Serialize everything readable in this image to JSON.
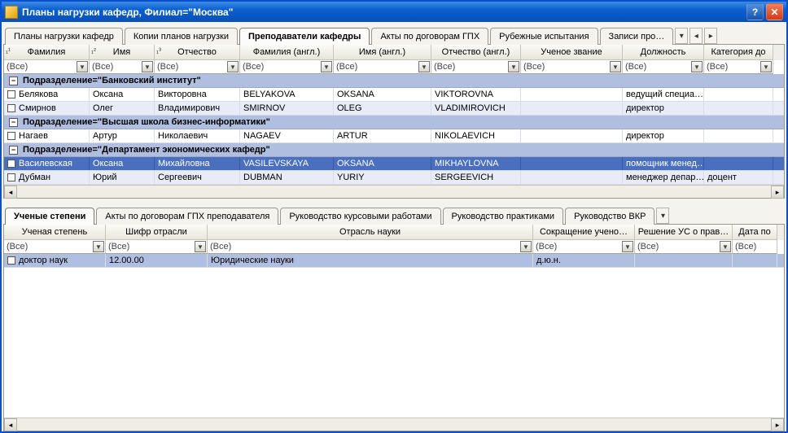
{
  "window": {
    "title": "Планы нагрузки кафедр, Филиал=\"Москва\""
  },
  "tabs": {
    "t0": "Планы нагрузки кафедр",
    "t1": "Копии планов нагрузки",
    "t2": "Преподаватели кафедры",
    "t3": "Акты по договорам ГПХ",
    "t4": "Рубежные испытания",
    "t5": "Записи про…"
  },
  "columns": {
    "surname": "Фамилия",
    "name": "Имя",
    "patr": "Отчество",
    "surname_en": "Фамилия (англ.)",
    "name_en": "Имя (англ.)",
    "patr_en": "Отчество (англ.)",
    "rank": "Ученое звание",
    "position": "Должность",
    "category": "Категория до"
  },
  "filter": "(Все)",
  "groups": {
    "g0": "Подразделение=\"Банковский институт\"",
    "g1": "Подразделение=\"Высшая школа бизнес-информатики\"",
    "g2": "Подразделение=\"Департамент экономических кафедр\""
  },
  "rows": {
    "r0": {
      "surname": "Белякова",
      "name": "Оксана",
      "patr": "Викторовна",
      "surname_en": "BELYAKOVA",
      "name_en": "OKSANA",
      "patr_en": "VIKTOROVNA",
      "rank": "",
      "position": "ведущий специа…",
      "category": ""
    },
    "r1": {
      "surname": "Смирнов",
      "name": "Олег",
      "patr": "Владимирович",
      "surname_en": "SMIRNOV",
      "name_en": "OLEG",
      "patr_en": "VLADIMIROVICH",
      "rank": "",
      "position": "директор",
      "category": ""
    },
    "r2": {
      "surname": "Нагаев",
      "name": "Артур",
      "patr": "Николаевич",
      "surname_en": "NAGAEV",
      "name_en": "ARTUR",
      "patr_en": "NIKOLAEVICH",
      "rank": "",
      "position": "директор",
      "category": ""
    },
    "r3": {
      "surname": "Василевская",
      "name": "Оксана",
      "patr": "Михайловна",
      "surname_en": "VASILEVSKAYA",
      "name_en": "OKSANA",
      "patr_en": "MIKHAYLOVNA",
      "rank": "",
      "position": "помощник менед…",
      "category": ""
    },
    "r4": {
      "surname": "Дубман",
      "name": "Юрий",
      "patr": "Сергеевич",
      "surname_en": "DUBMAN",
      "name_en": "YURIY",
      "patr_en": "SERGEEVICH",
      "rank": "",
      "position": "менеджер депар…",
      "category": "доцент"
    }
  },
  "lowerTabs": {
    "lt0": "Ученые степени",
    "lt1": "Акты по договорам ГПХ преподавателя",
    "lt2": "Руководство курсовыми работами",
    "lt3": "Руководство практиками",
    "lt4": "Руководство ВКР"
  },
  "lowerColumns": {
    "degree": "Ученая степень",
    "code": "Шифр отрасли",
    "branch": "Отрасль науки",
    "abbr": "Сокращение учено…",
    "decision": "Решение УС о прав…",
    "date": "Дата по"
  },
  "lowerRow": {
    "degree": "доктор наук",
    "code": "12.00.00",
    "branch": "Юридические науки",
    "abbr": "д.ю.н.",
    "decision": "",
    "date": ""
  }
}
